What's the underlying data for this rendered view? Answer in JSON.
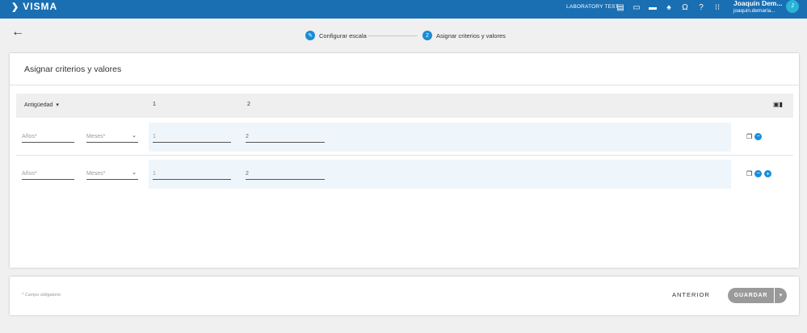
{
  "header": {
    "brand": "VISMA",
    "tenant": "LABORATORY TEST",
    "icons": [
      "sheet-icon",
      "monitor-icon",
      "folder-icon",
      "bell-icon",
      "headset-icon",
      "help-icon",
      "apps-grid-icon"
    ],
    "user_name": "Joaquin Dem...",
    "user_email": "joaquin.demaria...",
    "avatar_initial": "J"
  },
  "stepper": {
    "steps": [
      {
        "label": "Configurar escala",
        "marker": "✎"
      },
      {
        "label": "Asignar criterios y valores",
        "marker": "2"
      }
    ]
  },
  "main": {
    "title": "Asignar criterios y valores",
    "table": {
      "criterion_header": "Antigüedad",
      "value_headers": [
        "1",
        "2"
      ],
      "rows": [
        {
          "anos_placeholder": "Años*",
          "meses_placeholder": "Meses*",
          "values": [
            "1",
            "2"
          ]
        },
        {
          "anos_placeholder": "Años*",
          "meses_placeholder": "Meses*",
          "values": [
            "1",
            "2"
          ]
        }
      ]
    }
  },
  "footer": {
    "required_note": "* Campo obligatorio",
    "previous_label": "ANTERIOR",
    "save_label": "GUARDAR"
  },
  "colors": {
    "topbar": "#1a6fb3",
    "accent": "#1a8cd8",
    "value_band": "#eef6fc",
    "button_gray": "#9a9a9a"
  }
}
